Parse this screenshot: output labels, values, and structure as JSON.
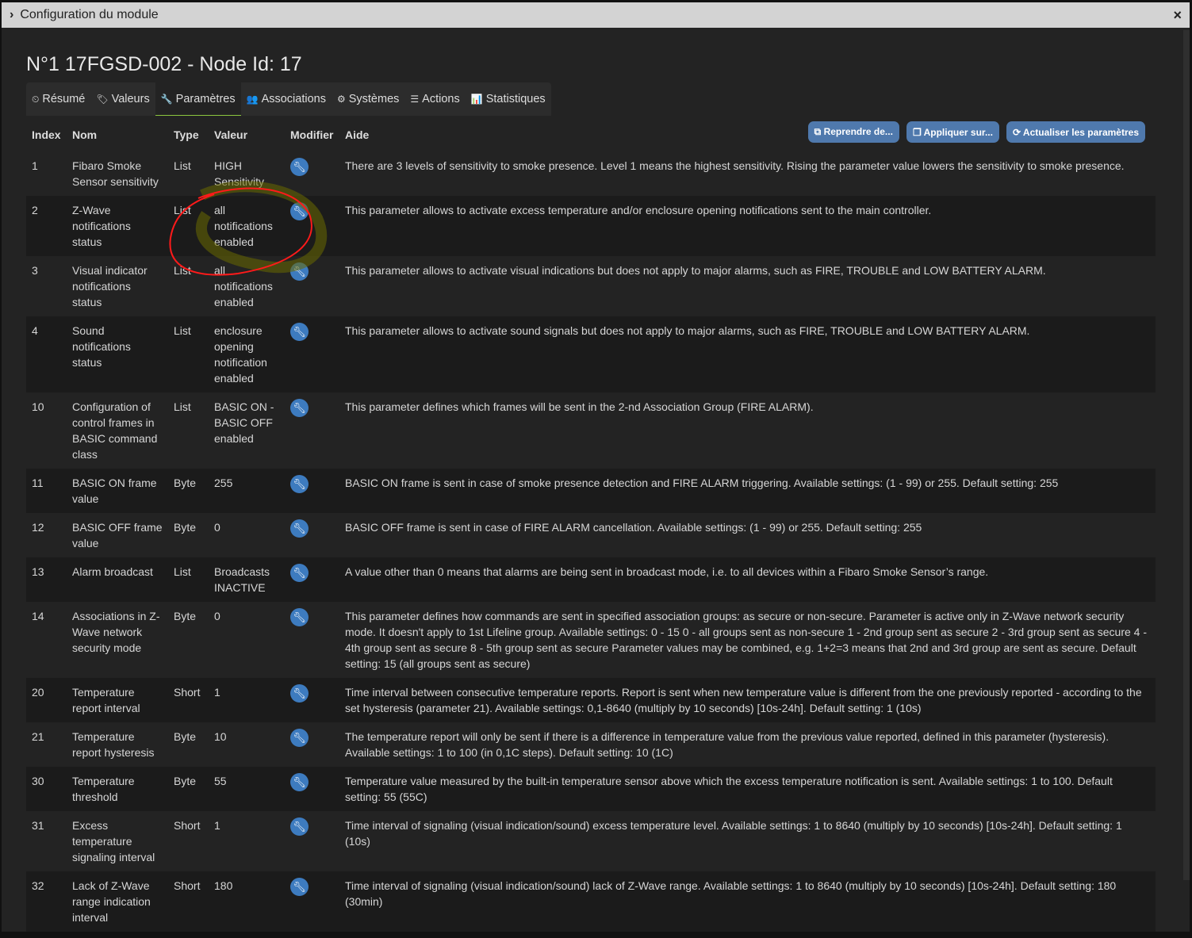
{
  "window": {
    "title": "Configuration du module",
    "close": "×"
  },
  "page_title": "N°1 17FGSD-002 - Node Id: 17",
  "tabs": [
    {
      "label": "Résumé",
      "icon": "⏲"
    },
    {
      "label": "Valeurs",
      "icon": "🏷"
    },
    {
      "label": "Paramètres",
      "icon": "🔧"
    },
    {
      "label": "Associations",
      "icon": "👥"
    },
    {
      "label": "Systèmes",
      "icon": "⚙"
    },
    {
      "label": "Actions",
      "icon": "☰"
    },
    {
      "label": "Statistiques",
      "icon": "📊"
    }
  ],
  "buttons": {
    "reprendre": "Reprendre de...",
    "appliquer": "Appliquer sur...",
    "actualiser": "Actualiser les paramètres"
  },
  "columns": [
    "Index",
    "Nom",
    "Type",
    "Valeur",
    "Modifier",
    "Aide"
  ],
  "rows": [
    {
      "index": "1",
      "name": "Fibaro Smoke Sensor sensitivity",
      "type": "List",
      "value": "HIGH Sensitivity",
      "help": "There are 3 levels of sensitivity to smoke presence. Level 1 means the highest sensitivity. Rising the parameter value lowers the sensitivity to smoke presence."
    },
    {
      "index": "2",
      "name": "Z-Wave notifications status",
      "type": "List",
      "value": "all notifications enabled",
      "help": "This parameter allows to activate excess temperature and/or enclosure opening notifications sent to the main controller."
    },
    {
      "index": "3",
      "name": "Visual indicator notifications status",
      "type": "List",
      "value": "all notifications enabled",
      "help": "This parameter allows to activate visual indications but does not apply to major alarms, such as FIRE, TROUBLE and LOW BATTERY ALARM."
    },
    {
      "index": "4",
      "name": "Sound notifications status",
      "type": "List",
      "value": "enclosure opening notification enabled",
      "help": "This parameter allows to activate sound signals but does not apply to major alarms, such as FIRE, TROUBLE and LOW BATTERY ALARM."
    },
    {
      "index": "10",
      "name": "Configuration of control frames in BASIC command class",
      "type": "List",
      "value": "BASIC ON - BASIC OFF enabled",
      "help": "This parameter defines which frames will be sent in the 2-nd Association Group (FIRE ALARM)."
    },
    {
      "index": "11",
      "name": "BASIC ON frame value",
      "type": "Byte",
      "value": "255",
      "help": "BASIC ON frame is sent in case of smoke presence detection and FIRE ALARM triggering. Available settings: (1 - 99) or 255. Default setting: 255"
    },
    {
      "index": "12",
      "name": "BASIC OFF frame value",
      "type": "Byte",
      "value": "0",
      "help": "BASIC OFF frame is sent in case of FIRE ALARM cancellation. Available settings: (1 - 99) or 255. Default setting: 255"
    },
    {
      "index": "13",
      "name": "Alarm broadcast",
      "type": "List",
      "value": "Broadcasts INACTIVE",
      "help": "A value other than 0 means that alarms are being sent in broadcast mode, i.e. to all devices within a Fibaro Smoke Sensor’s range."
    },
    {
      "index": "14",
      "name": "Associations in Z-Wave network security mode",
      "type": "Byte",
      "value": "0",
      "help": "This parameter defines how commands are sent in specified association groups: as secure or non-secure. Parameter is active only in Z-Wave network security mode. It doesn't apply to 1st Lifeline group. Available settings: 0 - 15 0 - all groups sent as non-secure 1 - 2nd group sent as secure 2 - 3rd group sent as secure 4 - 4th group sent as secure 8 - 5th group sent as secure Parameter values may be combined, e.g. 1+2=3 means that 2nd and 3rd group are sent as secure. Default setting: 15 (all groups sent as secure)"
    },
    {
      "index": "20",
      "name": "Temperature report interval",
      "type": "Short",
      "value": "1",
      "help": "Time interval between consecutive temperature reports. Report is sent when new temperature value is different from the one previously reported - according to the set hysteresis (parameter 21). Available settings: 0,1-8640 (multiply by 10 seconds) [10s-24h]. Default setting: 1 (10s)"
    },
    {
      "index": "21",
      "name": "Temperature report hysteresis",
      "type": "Byte",
      "value": "10",
      "help": "The temperature report will only be sent if there is a difference in temperature value from the previous value reported, defined in this parameter (hysteresis). Available settings: 1 to 100 (in 0,1C steps). Default setting: 10 (1C)"
    },
    {
      "index": "30",
      "name": "Temperature threshold",
      "type": "Byte",
      "value": "55",
      "help": "Temperature value measured by the built-in temperature sensor above which the excess temperature notification is sent. Available settings: 1 to 100. Default setting: 55 (55C)"
    },
    {
      "index": "31",
      "name": "Excess temperature signaling interval",
      "type": "Short",
      "value": "1",
      "help": "Time interval of signaling (visual indication/sound) excess temperature level. Available settings: 1 to 8640 (multiply by 10 seconds) [10s-24h]. Default setting: 1 (10s)"
    },
    {
      "index": "32",
      "name": "Lack of Z-Wave range indication interval",
      "type": "Short",
      "value": "180",
      "help": "Time interval of signaling (visual indication/sound) lack of Z-Wave range. Available settings: 1 to 8640 (multiply by 10 seconds) [10s-24h]. Default setting: 180 (30min)"
    }
  ]
}
